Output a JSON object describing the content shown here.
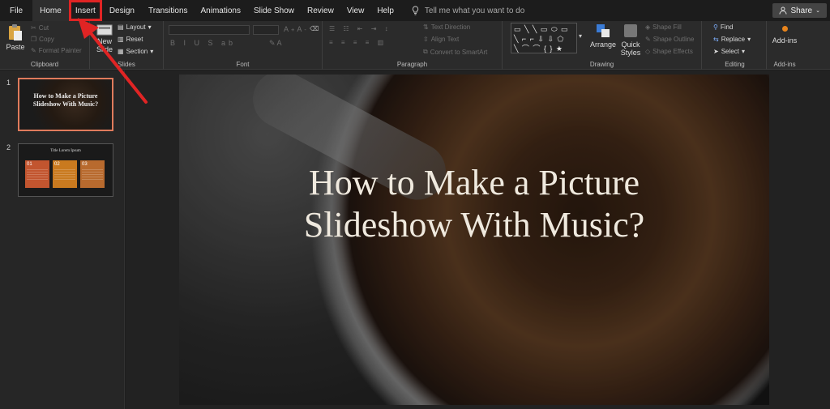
{
  "tabs": [
    {
      "label": "File",
      "active": false
    },
    {
      "label": "Home",
      "active": true
    },
    {
      "label": "Insert",
      "active": false,
      "highlighted": true
    },
    {
      "label": "Design",
      "active": false
    },
    {
      "label": "Transitions",
      "active": false
    },
    {
      "label": "Animations",
      "active": false
    },
    {
      "label": "Slide Show",
      "active": false
    },
    {
      "label": "Review",
      "active": false
    },
    {
      "label": "View",
      "active": false
    },
    {
      "label": "Help",
      "active": false
    }
  ],
  "tellme": "Tell me what you want to do",
  "share": "Share",
  "ribbon": {
    "clipboard": {
      "label": "Clipboard",
      "paste": "Paste",
      "cut": "Cut",
      "copy": "Copy",
      "format_painter": "Format Painter"
    },
    "slides": {
      "label": "Slides",
      "new": "New",
      "slide": "Slide",
      "layout": "Layout",
      "reset": "Reset",
      "section": "Section"
    },
    "font": {
      "label": "Font"
    },
    "paragraph": {
      "label": "Paragraph",
      "text_direction": "Text Direction",
      "align_text": "Align Text",
      "convert": "Convert to SmartArt"
    },
    "drawing": {
      "label": "Drawing",
      "arrange": "Arrange",
      "quick_styles_1": "Quick",
      "quick_styles_2": "Styles",
      "shape_fill": "Shape Fill",
      "shape_outline": "Shape Outline",
      "shape_effects": "Shape Effects"
    },
    "editing": {
      "label": "Editing",
      "find": "Find",
      "replace": "Replace",
      "select": "Select"
    },
    "addins": {
      "label": "Add-ins",
      "button": "Add-ins"
    }
  },
  "thumbnails": [
    {
      "num": "1",
      "title": "How to Make a Picture Slideshow With Music?"
    },
    {
      "num": "2",
      "title": "Title Lorem Ipsum",
      "cards": [
        "01",
        "02",
        "03"
      ]
    }
  ],
  "slide": {
    "title_line1": "How to Make a Picture",
    "title_line2": "Slideshow With Music?"
  },
  "colors": {
    "accent_highlight": "#e02424",
    "thumb_selected": "#e07b5c",
    "card1": "#c2552f",
    "card2": "#c97a1f",
    "card3": "#b86a2e"
  }
}
